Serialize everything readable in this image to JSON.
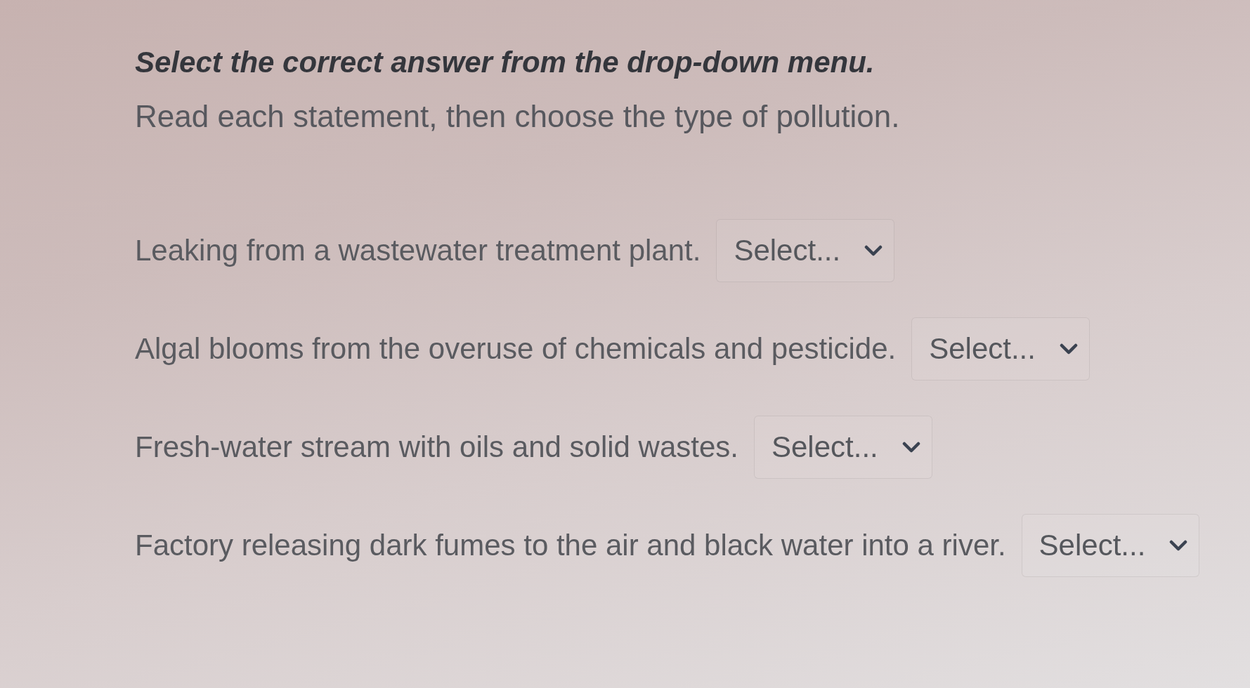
{
  "instructions": {
    "title": "Select the correct answer from the drop-down menu.",
    "subtitle": "Read each statement, then choose the type of pollution."
  },
  "questions": [
    {
      "statement": "Leaking from a wastewater treatment plant.",
      "dropdown": {
        "placeholder": "Select..."
      }
    },
    {
      "statement": "Algal blooms from the overuse of chemicals and pesticide.",
      "dropdown": {
        "placeholder": "Select..."
      }
    },
    {
      "statement": "Fresh-water stream with oils and solid wastes.",
      "dropdown": {
        "placeholder": "Select..."
      }
    },
    {
      "statement": "Factory releasing dark fumes to the air and black water into a river.",
      "dropdown": {
        "placeholder": "Select..."
      }
    }
  ]
}
